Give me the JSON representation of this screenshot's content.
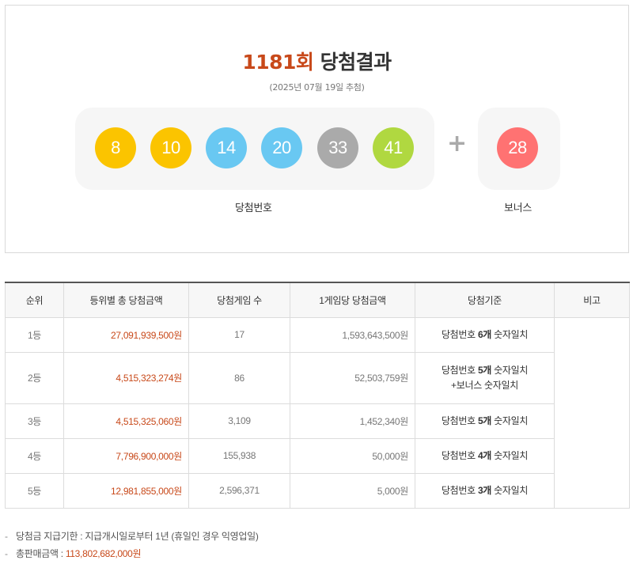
{
  "result": {
    "draw_no": "1181",
    "draw_no_suffix": "회",
    "title_rest": "당첨결과",
    "draw_date": "(2025년 07월 19일 추첨)",
    "numbers": [
      {
        "value": "8",
        "color": "#fbc400"
      },
      {
        "value": "10",
        "color": "#fbc400"
      },
      {
        "value": "14",
        "color": "#69c8f2"
      },
      {
        "value": "20",
        "color": "#69c8f2"
      },
      {
        "value": "33",
        "color": "#aaaaaa"
      },
      {
        "value": "41",
        "color": "#b0d840"
      }
    ],
    "plus": "+",
    "bonus": {
      "value": "28",
      "color": "#ff7272"
    },
    "numbers_caption": "당첨번호",
    "bonus_caption": "보너스"
  },
  "table": {
    "headers": [
      "순위",
      "등위별 총 당첨금액",
      "당첨게임 수",
      "1게임당 당첨금액",
      "당첨기준",
      "비고"
    ],
    "rows": [
      {
        "rank": "1등",
        "total": "27,091,939,500원",
        "games": "17",
        "per_game": "1,593,643,500원",
        "crit_a": "당첨번호 ",
        "crit_b": "6개",
        "crit_c": " 숫자일치",
        "crit_line2": ""
      },
      {
        "rank": "2등",
        "total": "4,515,323,274원",
        "games": "86",
        "per_game": "52,503,759원",
        "crit_a": "당첨번호 ",
        "crit_b": "5개",
        "crit_c": " 숫자일치",
        "crit_line2": "+보너스 숫자일치"
      },
      {
        "rank": "3등",
        "total": "4,515,325,060원",
        "games": "3,109",
        "per_game": "1,452,340원",
        "crit_a": "당첨번호 ",
        "crit_b": "5개",
        "crit_c": " 숫자일치",
        "crit_line2": ""
      },
      {
        "rank": "4등",
        "total": "7,796,900,000원",
        "games": "155,938",
        "per_game": "50,000원",
        "crit_a": "당첨번호 ",
        "crit_b": "4개",
        "crit_c": " 숫자일치",
        "crit_line2": ""
      },
      {
        "rank": "5등",
        "total": "12,981,855,000원",
        "games": "2,596,371",
        "per_game": "5,000원",
        "crit_a": "당첨번호 ",
        "crit_b": "3개",
        "crit_c": " 숫자일치",
        "crit_line2": ""
      }
    ]
  },
  "notes": {
    "dash": "-",
    "deadline": "당첨금 지급기한 : 지급개시일로부터 1년 (휴일인 경우 익영업일)",
    "sales_label": "총판매금액 : ",
    "sales_value": "113,802,682,000원"
  }
}
